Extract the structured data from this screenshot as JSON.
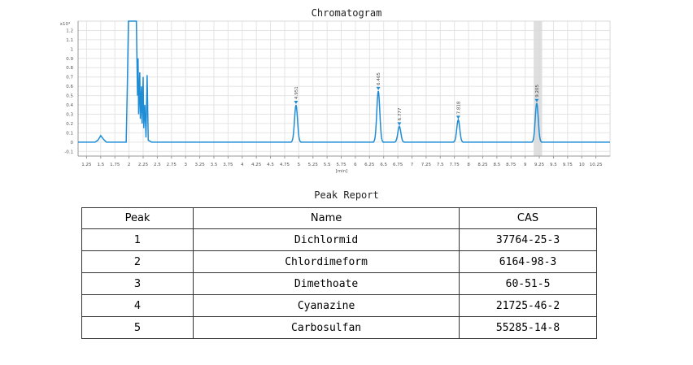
{
  "chart_data": {
    "type": "line",
    "title": "Chromatogram",
    "xlabel": "[min]",
    "ylabel": "",
    "y_exponent_label": "x10⁴",
    "xlim": [
      1.1,
      10.5
    ],
    "ylim": [
      -0.15,
      1.3
    ],
    "x_ticks": [
      "1.25",
      "1.5",
      "1.75",
      "2",
      "2.25",
      "2.5",
      "2.75",
      "3",
      "3.25",
      "3.5",
      "3.75",
      "4",
      "4.25",
      "4.5",
      "4.75",
      "5",
      "5.25",
      "5.5",
      "5.75",
      "6",
      "6.25",
      "6.5",
      "6.75",
      "7",
      "7.25",
      "7.5",
      "7.75",
      "8",
      "8.25",
      "8.5",
      "8.75",
      "9",
      "9.25",
      "9.5",
      "9.75",
      "10",
      "10.25"
    ],
    "y_ticks": [
      "-0.1",
      "0",
      "0.1",
      "0.2",
      "0.3",
      "0.4",
      "0.5",
      "0.6",
      "0.7",
      "0.8",
      "0.9",
      "1",
      "1.1",
      "1.2"
    ],
    "grid": true,
    "highlight_band": [
      9.15,
      9.3
    ],
    "baseline": 0.0,
    "solvent_region": [
      {
        "x": 1.4,
        "y": 0.0
      },
      {
        "x": 1.45,
        "y": 0.02
      },
      {
        "x": 1.5,
        "y": 0.07
      },
      {
        "x": 1.55,
        "y": 0.03
      },
      {
        "x": 1.6,
        "y": 0.0
      },
      {
        "x": 1.95,
        "y": 0.0
      },
      {
        "x": 1.97,
        "y": 0.6
      },
      {
        "x": 1.99,
        "y": 1.3
      },
      {
        "x": 2.1,
        "y": 1.3
      },
      {
        "x": 2.13,
        "y": 1.3
      },
      {
        "x": 2.15,
        "y": 0.5
      },
      {
        "x": 2.16,
        "y": 0.9
      },
      {
        "x": 2.17,
        "y": 0.3
      },
      {
        "x": 2.19,
        "y": 0.75
      },
      {
        "x": 2.2,
        "y": 0.25
      },
      {
        "x": 2.22,
        "y": 0.6
      },
      {
        "x": 2.23,
        "y": 0.2
      },
      {
        "x": 2.25,
        "y": 0.7
      },
      {
        "x": 2.26,
        "y": 0.15
      },
      {
        "x": 2.28,
        "y": 0.4
      },
      {
        "x": 2.3,
        "y": 0.05
      },
      {
        "x": 2.32,
        "y": 0.72
      },
      {
        "x": 2.34,
        "y": 0.02
      },
      {
        "x": 2.4,
        "y": 0.0
      }
    ],
    "peaks": [
      {
        "rt": 4.951,
        "label": "4.951",
        "height": 0.4,
        "color": "#1f8dd6"
      },
      {
        "rt": 6.405,
        "label": "6.405",
        "height": 0.55,
        "color": "#1f8dd6"
      },
      {
        "rt": 6.777,
        "label": "6.777",
        "height": 0.17,
        "color": "#1f8dd6"
      },
      {
        "rt": 7.818,
        "label": "7.818",
        "height": 0.24,
        "color": "#1f8dd6"
      },
      {
        "rt": 9.205,
        "label": "9.205",
        "height": 0.42,
        "color": "#1f8dd6"
      }
    ],
    "line_color": "#1f8dd6"
  },
  "report": {
    "title": "Peak Report",
    "headers": [
      "Peak",
      "Name",
      "CAS"
    ],
    "rows": [
      [
        "1",
        "Dichlormid",
        "37764-25-3"
      ],
      [
        "2",
        "Chlordimeform",
        "6164-98-3"
      ],
      [
        "3",
        "Dimethoate",
        "60-51-5"
      ],
      [
        "4",
        "Cyanazine",
        "21725-46-2"
      ],
      [
        "5",
        "Carbosulfan",
        "55285-14-8"
      ]
    ]
  }
}
